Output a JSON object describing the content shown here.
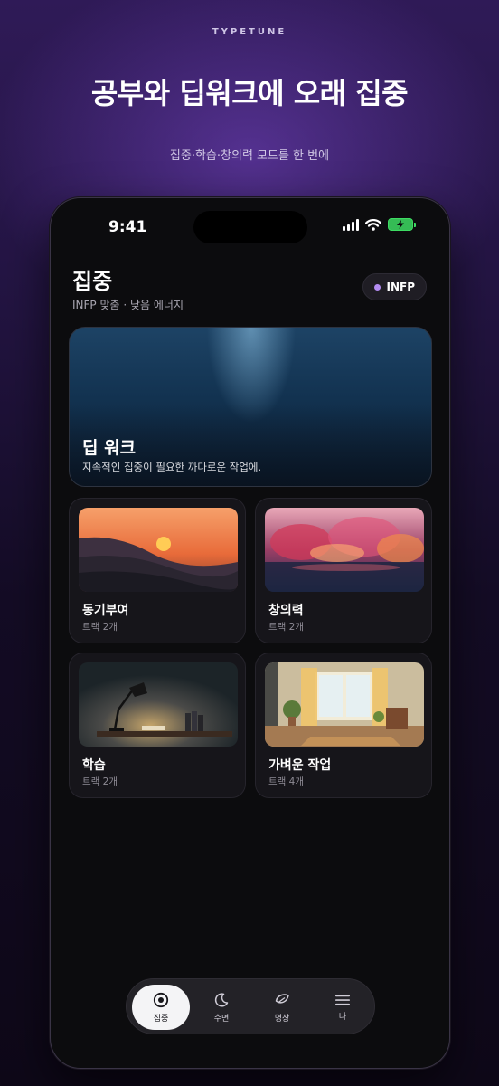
{
  "page": {
    "brand": "TYPETUNE",
    "headline": "공부와 딥워크에 오래 집중",
    "subline": "집중·학습·창의력 모드를 한 번에"
  },
  "status_bar": {
    "time": "9:41"
  },
  "screen": {
    "title": "집중",
    "subtitle": "INFP 맞춤 · 낮음 에너지",
    "chip_label": "INFP"
  },
  "hero": {
    "title": "딥 워크",
    "description": "지속적인 집중이 필요한 까다로운 작업에."
  },
  "cards": [
    {
      "title": "동기부여",
      "meta": "트랙 2개"
    },
    {
      "title": "창의력",
      "meta": "트랙 2개"
    },
    {
      "title": "학습",
      "meta": "트랙 2개"
    },
    {
      "title": "가벼운 작업",
      "meta": "트랙 4개"
    }
  ],
  "tabs": [
    {
      "label": "집중",
      "icon": "target-icon",
      "active": true
    },
    {
      "label": "수면",
      "icon": "moon-icon",
      "active": false
    },
    {
      "label": "명상",
      "icon": "leaf-icon",
      "active": false
    },
    {
      "label": "나",
      "icon": "menu-icon",
      "active": false
    }
  ],
  "colors": {
    "accent": "#b48cf2",
    "battery": "#3ddc62"
  }
}
